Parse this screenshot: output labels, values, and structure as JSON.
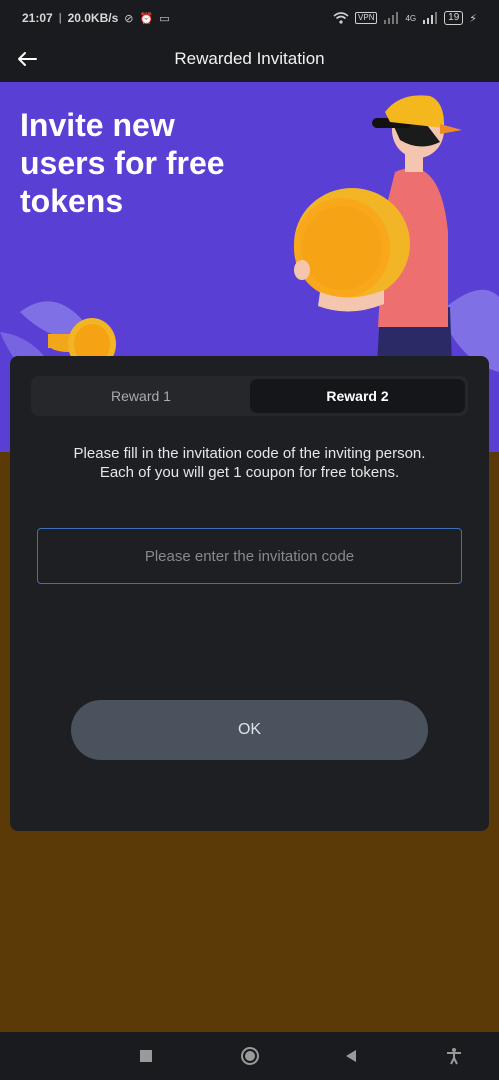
{
  "status_bar": {
    "time": "21:07",
    "speed": "20.0KB/s",
    "vpn_label": "VPN",
    "network": "4G",
    "battery": "19"
  },
  "app_bar": {
    "title": "Rewarded Invitation",
    "back_icon": "arrow-left-icon"
  },
  "hero": {
    "title": "Invite new users for free tokens",
    "background_color": "#5a3fd4"
  },
  "tabs": [
    {
      "label": "Reward 1",
      "selected": false
    },
    {
      "label": "Reward 2",
      "selected": true
    }
  ],
  "invite": {
    "description_line1": "Please fill in the invitation code of the inviting person.",
    "description_line2": "Each of you will get 1 coupon for free tokens.",
    "code_value": "",
    "code_placeholder": "Please enter the invitation code",
    "ok_label": "OK"
  },
  "nav_bar": {
    "icons": [
      "recents-square-icon",
      "home-circle-icon",
      "back-triangle-icon",
      "accessibility-icon"
    ]
  },
  "colors": {
    "accent_purple": "#5a3fd4",
    "brown_background": "#5c3a08",
    "card": "#1e1f23",
    "button": "#4a525e",
    "input_border": "#3c6fb8"
  }
}
